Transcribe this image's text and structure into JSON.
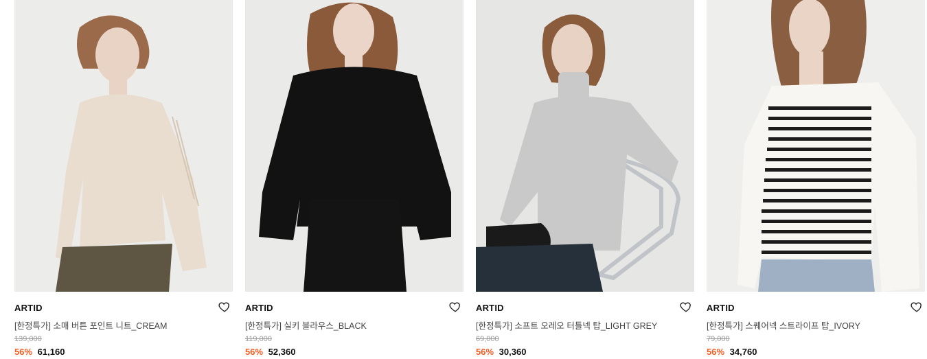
{
  "products": [
    {
      "brand": "ARTID",
      "name": "[한정특가] 소매 버튼 포인트 니트_CREAM",
      "original_price": "139,000",
      "discount": "56%",
      "price": "61,160",
      "image_colors": {
        "bg": "#ececea",
        "garment": "#e9ddd0",
        "hair": "#9a6a4a",
        "skin": "#e9d3c4",
        "pants": "#5e5543"
      }
    },
    {
      "brand": "ARTID",
      "name": "[한정특가] 실키 블라우스_BLACK",
      "original_price": "119,000",
      "discount": "56%",
      "price": "52,360",
      "image_colors": {
        "bg": "#eaeae8",
        "garment": "#121212",
        "hair": "#8a5a3b",
        "skin": "#ead5c8",
        "pants": "#141414"
      }
    },
    {
      "brand": "ARTID",
      "name": "[한정특가] 소프트 오레오 터틀넥 탑_LIGHT GREY",
      "original_price": "69,000",
      "discount": "56%",
      "price": "30,360",
      "image_colors": {
        "bg": "#e6e6e4",
        "garment": "#c9c9c9",
        "hair": "#8a5c3c",
        "skin": "#e8d2c4",
        "pants": "#26303b"
      }
    },
    {
      "brand": "ARTID",
      "name": "[한정특가] 스퀘어넥 스트라이프 탑_IVORY",
      "original_price": "79,000",
      "discount": "56%",
      "price": "34,760",
      "image_colors": {
        "bg": "#eeeeec",
        "garment": "#f7f6f2",
        "hair": "#8a5e40",
        "skin": "#ead4c6",
        "pants": "#9fb0c4"
      }
    }
  ]
}
